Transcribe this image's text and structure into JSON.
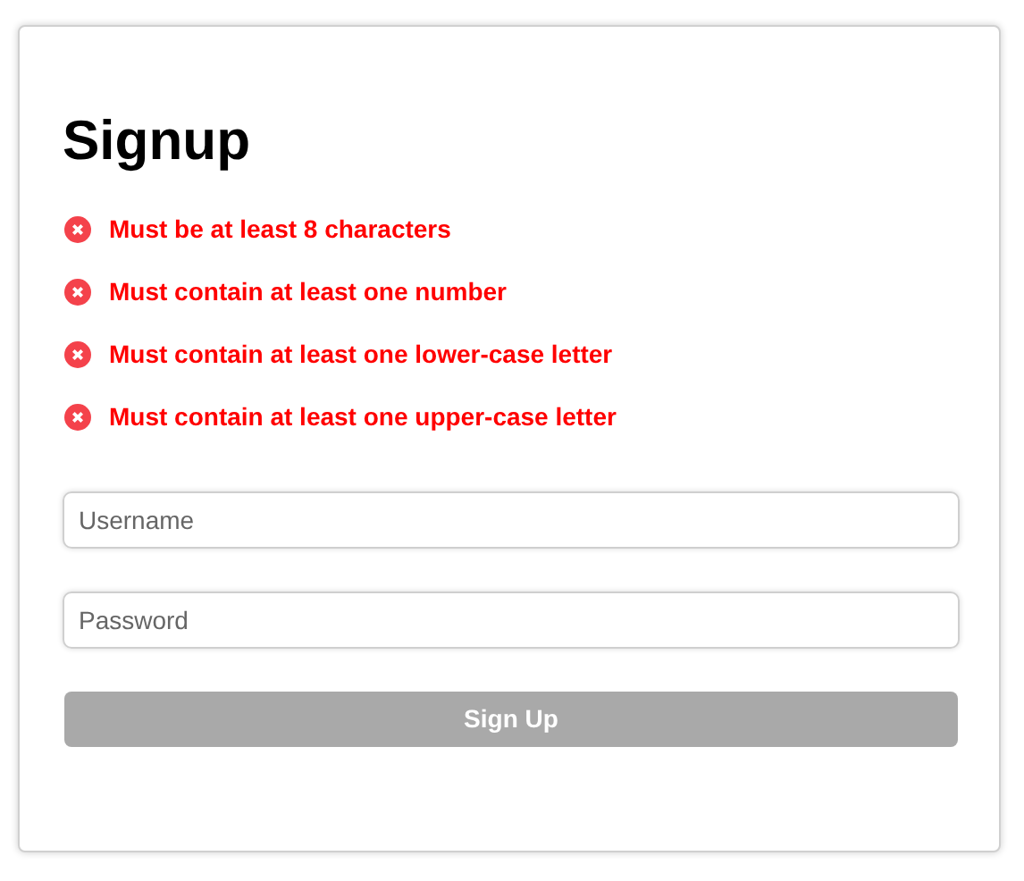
{
  "title": "Signup",
  "rules": [
    {
      "text": "Must be at least 8 characters",
      "met": false
    },
    {
      "text": "Must contain at least one number",
      "met": false
    },
    {
      "text": "Must contain at least one lower-case letter",
      "met": false
    },
    {
      "text": "Must contain at least one upper-case letter",
      "met": false
    }
  ],
  "fields": [
    {
      "placeholder": "Username"
    },
    {
      "placeholder": "Password"
    }
  ],
  "button": {
    "label": "Sign Up",
    "disabled": true
  }
}
